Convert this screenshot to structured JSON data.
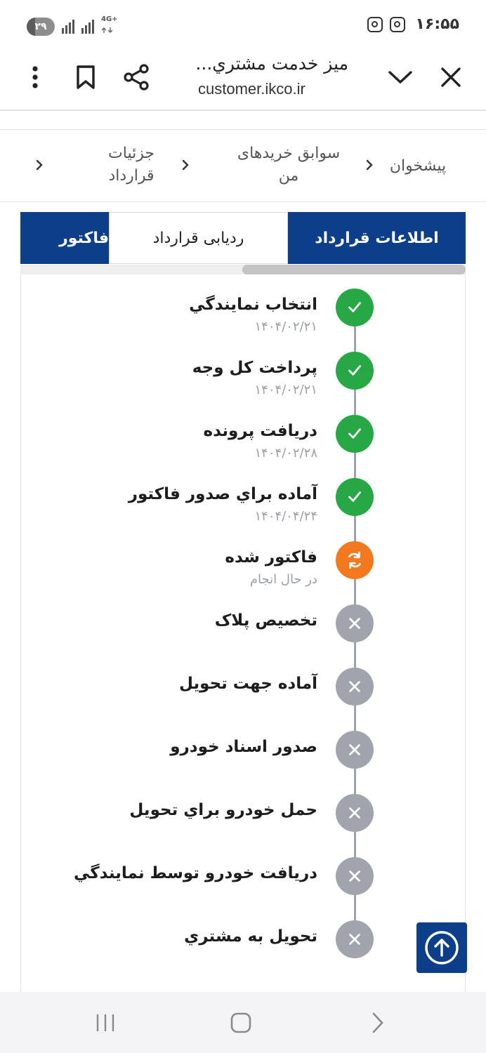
{
  "status_bar": {
    "battery": "۲۹",
    "battery_level": 0.29,
    "network_type": "4G+",
    "time": "۱۶:۵۵",
    "notification_icons": [
      "instagram-icon",
      "instagram-icon"
    ]
  },
  "browser": {
    "page_title": "ميز خدمت مشتري...",
    "url": "customer.ikco.ir",
    "buttons": [
      "close-icon",
      "chevron-down-icon",
      "share-icon",
      "bookmark-icon",
      "more-vertical-icon"
    ]
  },
  "breadcrumb": {
    "items": [
      {
        "line1": "پیشخوان",
        "line2": ""
      },
      {
        "line1": "سوابق خریدهای",
        "line2": "من"
      },
      {
        "line1": "جزئیات",
        "line2": "قرارداد"
      }
    ]
  },
  "tabs": {
    "items": [
      "اطلاعات قرارداد",
      "ردیابی قرارداد",
      "فاکتور"
    ],
    "active_index": 0
  },
  "timeline": {
    "steps": [
      {
        "title": "انتخاب نمايندگي",
        "subtitle": "۱۴۰۴/۰۲/۲۱",
        "status": "done"
      },
      {
        "title": "پرداخت کل وجه",
        "subtitle": "۱۴۰۴/۰۲/۲۱",
        "status": "done"
      },
      {
        "title": "دريافت پرونده",
        "subtitle": "۱۴۰۴/۰۲/۲۸",
        "status": "done"
      },
      {
        "title": "آماده براي صدور فاكتور",
        "subtitle": "۱۴۰۴/۰۴/۲۴",
        "status": "done"
      },
      {
        "title": "فاكتور شده",
        "subtitle": "در حال انجام",
        "status": "in-progress"
      },
      {
        "title": "تخصيص پلاک",
        "subtitle": "",
        "status": "pending"
      },
      {
        "title": "آماده جهت تحويل",
        "subtitle": "",
        "status": "pending"
      },
      {
        "title": "صدور اسناد خودرو",
        "subtitle": "",
        "status": "pending"
      },
      {
        "title": "حمل خودرو براي تحويل",
        "subtitle": "",
        "status": "pending"
      },
      {
        "title": "دريافت خودرو توسط نمايندگي",
        "subtitle": "",
        "status": "pending"
      },
      {
        "title": "تحويل به مشتري",
        "subtitle": "",
        "status": "pending"
      }
    ]
  },
  "colors": {
    "brand": "#0d3e8a",
    "done": "#27a844",
    "in_progress": "#f4791e",
    "pending": "#9fa4ad"
  },
  "nav_bar": {
    "buttons": [
      "recents-icon",
      "home-icon",
      "back-icon"
    ]
  }
}
